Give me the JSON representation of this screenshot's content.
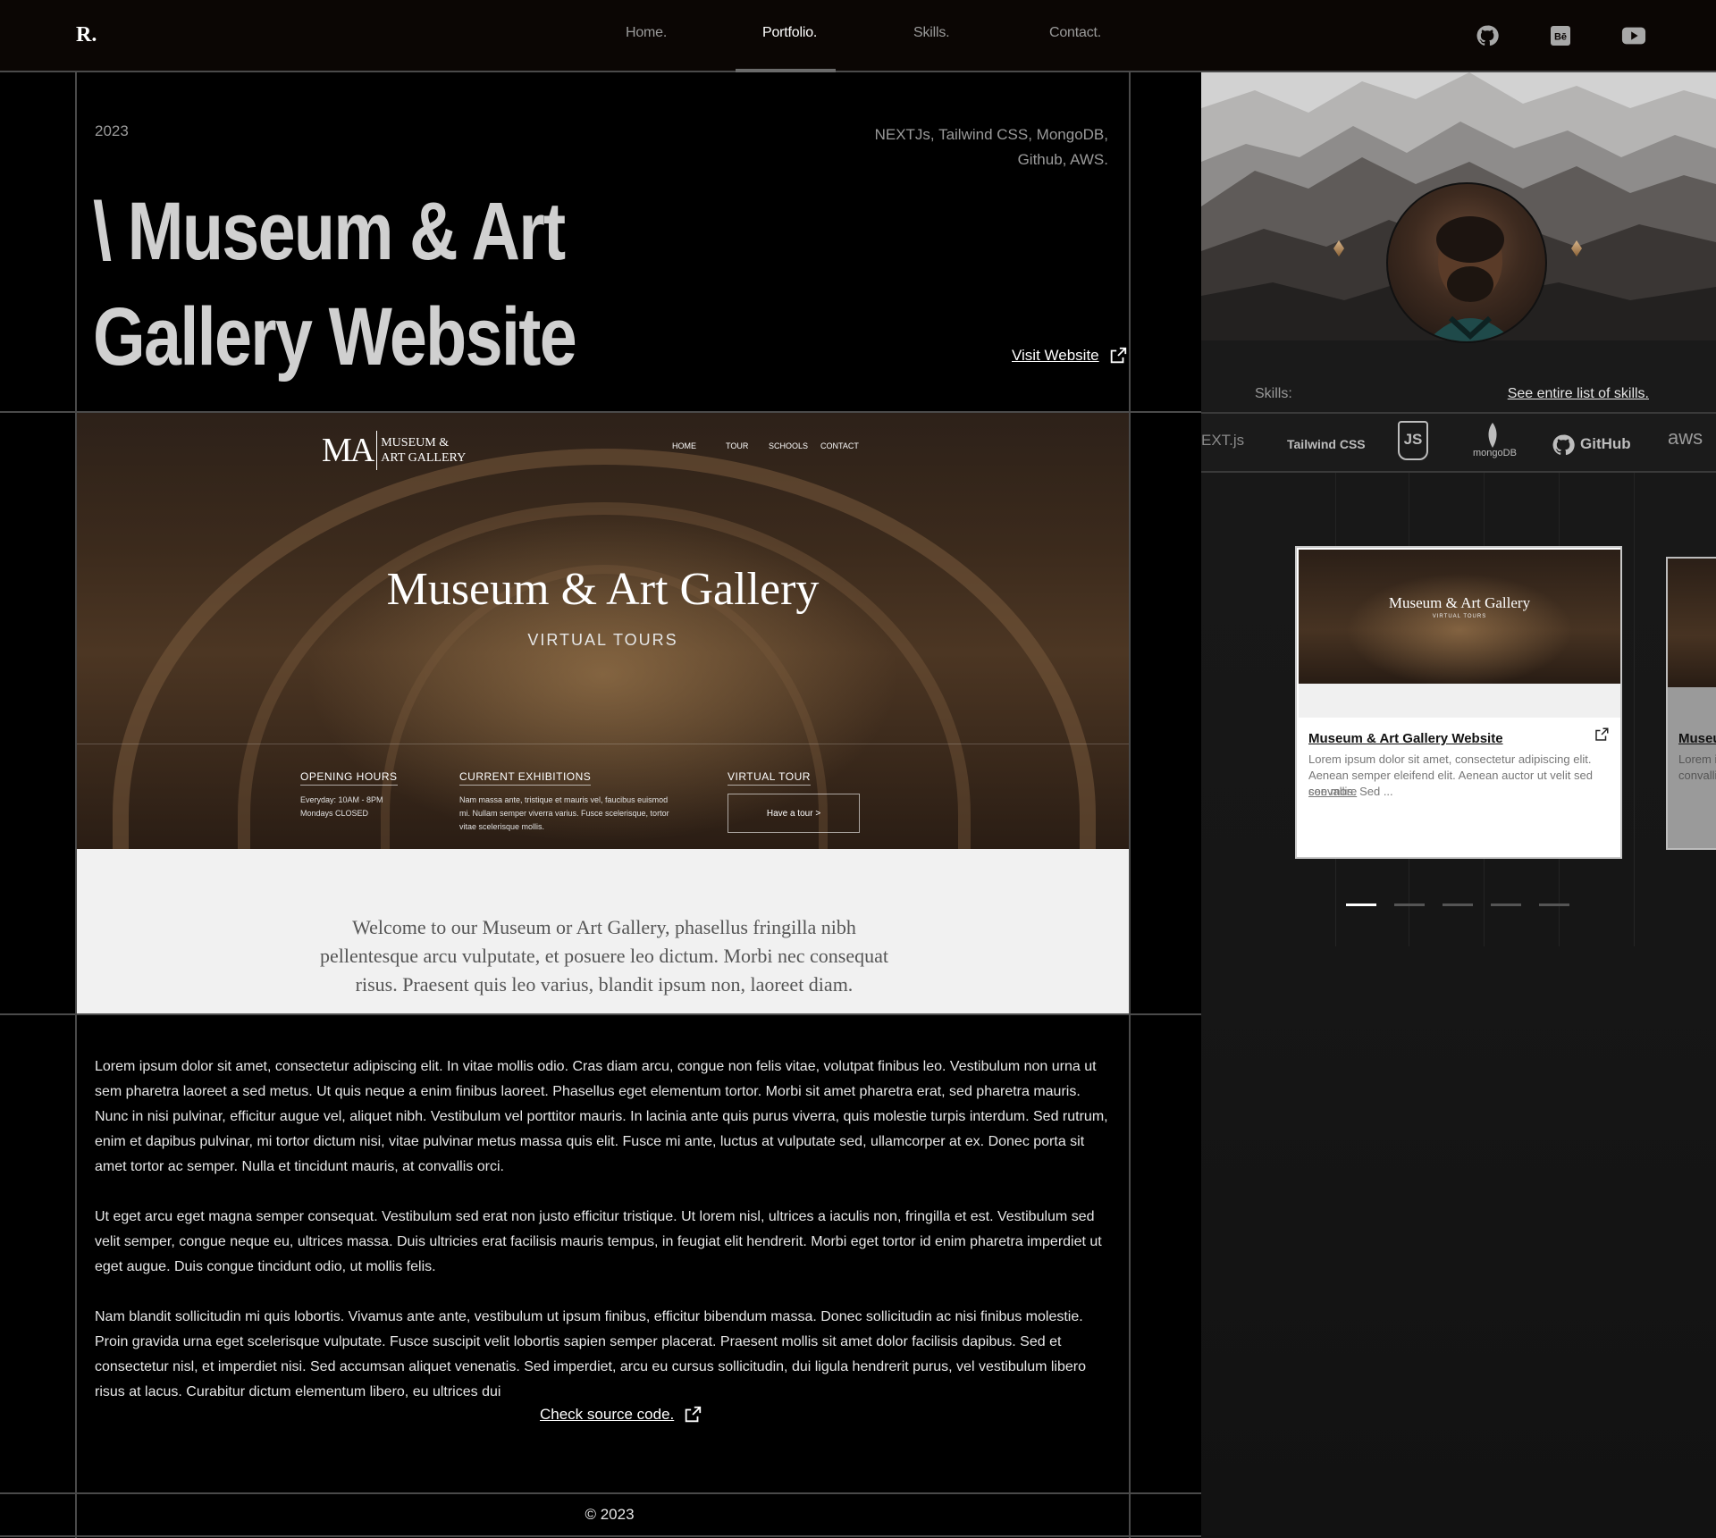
{
  "nav": {
    "logo": "R.",
    "links": [
      "Home.",
      "Portfolio.",
      "Skills.",
      "Contact."
    ],
    "active": "Portfolio.",
    "social": [
      "github-icon",
      "behance-icon",
      "youtube-icon"
    ]
  },
  "project": {
    "year": "2023",
    "tech": "NEXTJs, Tailwind CSS, MongoDB, Github, AWS.",
    "title_line1": "\\ Museum & Art",
    "title_line2": "Gallery Website",
    "visit_label": "Visit Website"
  },
  "preview": {
    "logo_ma": "MA",
    "logo_line1": "MUSEUM &",
    "logo_line2": "ART GALLERY",
    "menu": [
      "HOME",
      "TOUR",
      "SCHOOLS",
      "CONTACT"
    ],
    "heading": "Museum & Art Gallery",
    "subheading": "VIRTUAL TOURS",
    "col1_title": "OPENING HOURS",
    "col1_text1": "Everyday: 10AM - 8PM",
    "col1_text2": "Mondays CLOSED",
    "col2_title": "CURRENT EXHIBITIONS",
    "col2_text": "Nam massa ante, tristique et mauris vel, faucibus euismod mi. Nullam semper viverra varius. Fusce scelerisque, tortor vitae scelerisque mollis.",
    "col3_title": "VIRTUAL TOUR",
    "tour_button": "Have a tour >",
    "welcome": "Welcome to our Museum or Art Gallery, phasellus fringilla nibh pellentesque arcu vulputate, et posuere leo dictum. Morbi nec consequat risus. Praesent quis leo varius, blandit ipsum non, laoreet diam."
  },
  "body": {
    "p1": "Lorem ipsum dolor sit amet, consectetur adipiscing elit. In vitae mollis odio. Cras diam arcu, congue non felis vitae, volutpat finibus leo. Vestibulum non urna ut sem pharetra laoreet a sed metus. Ut quis neque a enim finibus laoreet. Phasellus eget elementum tortor. Morbi sit amet pharetra erat, sed pharetra mauris. Nunc in nisi pulvinar, efficitur augue vel, aliquet nibh. Vestibulum vel porttitor mauris. In lacinia ante quis purus viverra, quis molestie turpis interdum. Sed rutrum, enim et dapibus pulvinar, mi tortor dictum nisi, vitae pulvinar metus massa quis elit. Fusce mi ante, luctus at vulputate sed, ullamcorper at ex. Donec porta sit amet tortor ac semper. Nulla et tincidunt mauris, at convallis orci.",
    "p2": "Ut eget arcu eget magna semper consequat. Vestibulum sed erat non justo efficitur tristique. Ut lorem nisl, ultrices a iaculis non, fringilla et est. Vestibulum sed velit semper, congue neque eu, ultrices massa. Duis ultricies erat facilisis mauris tempus, in feugiat elit hendrerit. Morbi eget tortor id enim pharetra imperdiet ut eget augue. Duis congue tincidunt odio, ut mollis felis.",
    "p3": "Nam blandit sollicitudin mi quis lobortis. Vivamus ante ante, vestibulum ut ipsum finibus, efficitur bibendum massa. Donec sollicitudin ac nisi finibus molestie. Proin gravida urna eget scelerisque vulputate. Fusce suscipit velit lobortis sapien semper placerat. Praesent mollis sit amet dolor facilisis dapibus. Sed et consectetur nisl, et imperdiet nisi. Sed accumsan aliquet venenatis. Sed imperdiet, arcu eu cursus sollicitudin, dui ligula hendrerit purus, vel vestibulum libero risus at lacus. Curabitur dictum elementum libero, eu ultrices dui",
    "source_label": "Check source code.",
    "copyright": "© 2023"
  },
  "sidebar": {
    "skills_label": "Skills:",
    "skills_link": "See entire list of skills.",
    "skills": [
      "EXT.js",
      "Tailwind CSS",
      "JS",
      "mongoDB",
      "GitHub",
      "aws"
    ],
    "card": {
      "preview_title": "Museum & Art Gallery",
      "preview_sub": "VIRTUAL TOURS",
      "title": "Museum & Art Gallery Website",
      "desc": "Lorem ipsum dolor sit amet, consectetur adipiscing elit. Aenean semper eleifend elit. Aenean auctor ut velit sed convallis. Sed ...",
      "more": "see more"
    },
    "card2": {
      "title": "Museum & Art Gallery Website",
      "desc": "Lorem ipsum dolor sit amet, Aenean semper eleifend elit. convallis."
    },
    "carousel_active": 1,
    "carousel_count": 5
  }
}
